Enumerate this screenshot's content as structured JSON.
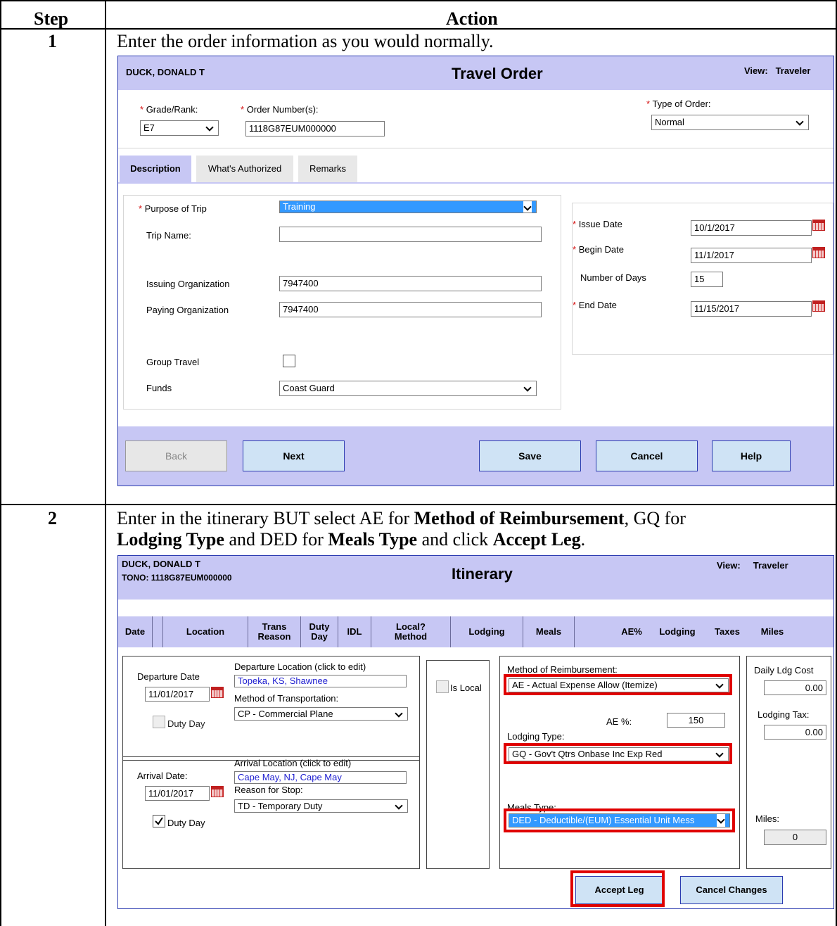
{
  "table": {
    "header_step": "Step",
    "header_action": "Action"
  },
  "step1": {
    "number": "1",
    "instruction": "Enter the order information as you would normally."
  },
  "travel_order": {
    "traveler_name": "DUCK, DONALD T",
    "title": "Travel Order",
    "view_label": "View:",
    "view_value": "Traveler",
    "grade_label": "Grade/Rank:",
    "grade_value": "E7",
    "order_number_label": "Order Number(s):",
    "order_number_value": "1118G87EUM000000",
    "type_label": "Type of Order:",
    "type_value": "Normal",
    "tabs": [
      "Description",
      "What's Authorized",
      "Remarks"
    ],
    "purpose_label": "Purpose of Trip",
    "purpose_value": "Training",
    "trip_name_label": "Trip Name:",
    "trip_name_value": "",
    "issuing_org_label": "Issuing Organization",
    "issuing_org_value": "7947400",
    "paying_org_label": "Paying Organization",
    "paying_org_value": "7947400",
    "group_travel_label": "Group Travel",
    "funds_label": "Funds",
    "funds_value": "Coast Guard",
    "issue_date_label": "Issue Date",
    "issue_date_value": "10/1/2017",
    "begin_date_label": "Begin Date",
    "begin_date_value": "11/1/2017",
    "num_days_label": "Number of Days",
    "num_days_value": "15",
    "end_date_label": "End Date",
    "end_date_value": "11/15/2017",
    "buttons": {
      "back": "Back",
      "next": "Next",
      "save": "Save",
      "cancel": "Cancel",
      "help": "Help"
    }
  },
  "step2": {
    "number": "2",
    "line1_pre": "Enter in the itinerary BUT select AE for ",
    "line1_bold": "Method of Reimbursement",
    "line1_post": ", GQ for",
    "line2_bold1": "Lodging Type",
    "line2_mid1": " and DED for ",
    "line2_bold2": "Meals Type",
    "line2_mid2": " and click ",
    "line2_bold3": "Accept Leg",
    "line2_end": "."
  },
  "itinerary": {
    "traveler_name": "DUCK, DONALD T",
    "tono": "TONO: 1118G87EUM000000",
    "title": "Itinerary",
    "view_label": "View:",
    "view_value": "Traveler",
    "columns": {
      "date": "Date",
      "location": "Location",
      "trans1": "Trans",
      "trans2": "Reason",
      "duty1": "Duty",
      "duty2": "Day",
      "idl": "IDL",
      "local1": "Local?",
      "local2": "Method",
      "lodging": "Lodging",
      "meals": "Meals",
      "ae": "AE%",
      "lodging2": "Lodging",
      "taxes": "Taxes",
      "miles": "Miles"
    },
    "departure_date_label": "Departure Date",
    "departure_date_value": "11/01/2017",
    "departure_location_label": "Departure Location (click to edit)",
    "departure_location_value": "Topeka, KS, Shawnee",
    "transport_label": "Method of Transportation:",
    "transport_value": "CP - Commercial Plane",
    "duty_day_label": "Duty Day",
    "arrival_date_label": "Arrival Date:",
    "arrival_date_value": "11/01/2017",
    "arrival_location_label": "Arrival Location (click to edit)",
    "arrival_location_value": "Cape May, NJ, Cape May",
    "reason_label": "Reason for Stop:",
    "reason_value": "TD - Temporary Duty",
    "is_local_label": "Is Local",
    "reimb_label": "Method of Reimbursement:",
    "reimb_value": "AE - Actual Expense Allow (Itemize)",
    "ae_label": "AE %:",
    "ae_value": "150",
    "lodging_type_label": "Lodging Type:",
    "lodging_type_value": "GQ - Gov't Qtrs Onbase Inc Exp Red",
    "meals_type_label": "Meals Type:",
    "meals_type_value": "DED - Deductible/(EUM) Essential Unit Mess",
    "daily_ldg_label": "Daily Ldg Cost",
    "daily_ldg_value": "0.00",
    "lodging_tax_label": "Lodging Tax:",
    "lodging_tax_value": "0.00",
    "miles_label": "Miles:",
    "miles_value": "0",
    "accept_leg": "Accept Leg",
    "cancel_changes": "Cancel Changes"
  },
  "colors": {
    "banner": "#c7c7f4",
    "button": "#cfe3f5",
    "highlight": "#e00000",
    "required": "#d51010"
  }
}
